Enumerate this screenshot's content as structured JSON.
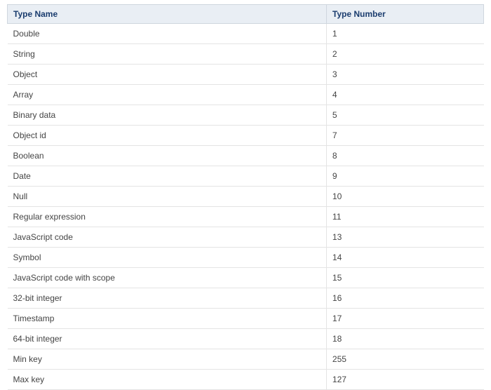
{
  "table": {
    "headers": {
      "name": "Type Name",
      "number": "Type Number"
    },
    "rows": [
      {
        "name": "Double",
        "number": "1"
      },
      {
        "name": "String",
        "number": "2"
      },
      {
        "name": "Object",
        "number": "3"
      },
      {
        "name": "Array",
        "number": "4"
      },
      {
        "name": "Binary data",
        "number": "5"
      },
      {
        "name": "Object id",
        "number": "7"
      },
      {
        "name": "Boolean",
        "number": "8"
      },
      {
        "name": "Date",
        "number": "9"
      },
      {
        "name": "Null",
        "number": "10"
      },
      {
        "name": "Regular expression",
        "number": "11"
      },
      {
        "name": "JavaScript code",
        "number": "13"
      },
      {
        "name": "Symbol",
        "number": "14"
      },
      {
        "name": "JavaScript code with scope",
        "number": "15"
      },
      {
        "name": "32-bit integer",
        "number": "16"
      },
      {
        "name": "Timestamp",
        "number": "17"
      },
      {
        "name": "64-bit integer",
        "number": "18"
      },
      {
        "name": "Min key",
        "number": "255"
      },
      {
        "name": "Max key",
        "number": "127"
      }
    ]
  }
}
